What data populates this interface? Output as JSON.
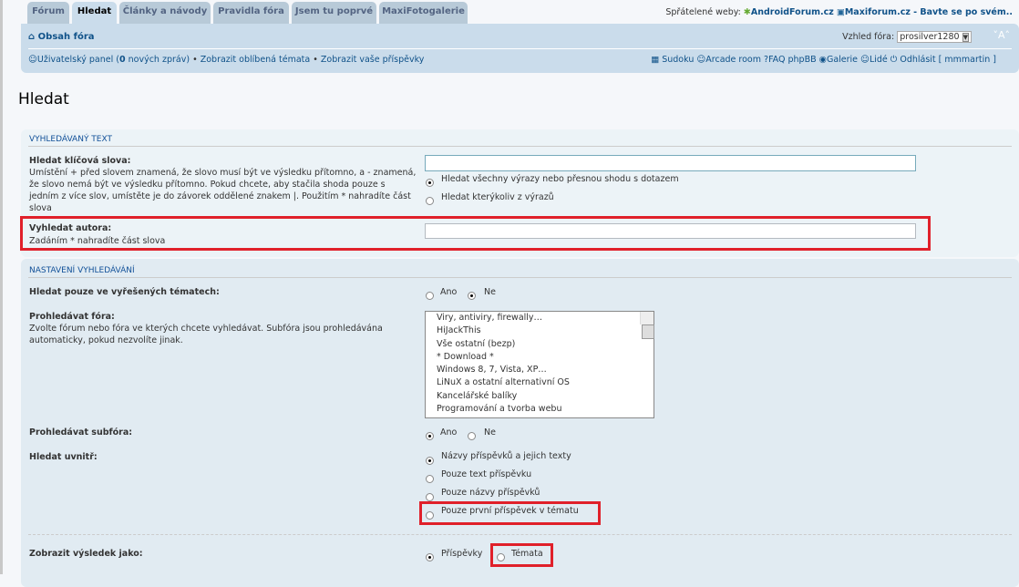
{
  "tabs": [
    "Fórum",
    "Hledat",
    "Články a návody",
    "Pravidla fóra",
    "Jsem tu poprvé",
    "MaxiFotogalerie"
  ],
  "friends": {
    "label": "Spřátelené weby:",
    "site1": "AndroidForum.cz",
    "site2": "Maxiforum.cz - Bavte se po svém.."
  },
  "nav": {
    "home": "Obsah fóra",
    "style_label": "Vzhled fóra:",
    "style_value": "prosilver1280",
    "font_size": "A",
    "ucp": "Uživatelský panel (",
    "new_count": "0",
    "new_msgs": " nových zpráv)",
    "bullet": "•",
    "fav": "Zobrazit oblíbená témata",
    "own": "Zobrazit vaše příspěvky",
    "right": [
      "Sudoku",
      "Arcade room",
      "FAQ phpBB",
      "Galerie",
      "Lidé",
      "Odhlásit [ mmmartin ]"
    ]
  },
  "page_title": "Hledat",
  "search_text": {
    "header": "Vyhledávaný text",
    "keywords_label": "Hledat klíčová slova:",
    "keywords_desc": "Umístění + před slovem znamená, že slovo musí být ve výsledku přítomno, a - znamená, že slovo nemá být ve výsledku přítomno. Pokud chcete, aby stačila shoda pouze s jedním z více slov, umístěte je do závorek oddělené znakem |. Použitím * nahradíte část slova",
    "opt_all": "Hledat všechny výrazy nebo přesnou shodu s dotazem",
    "opt_any": "Hledat kterýkoliv z výrazů",
    "author_label": "Vyhledat autora:",
    "author_desc": "Zadáním * nahradíte část slova"
  },
  "settings": {
    "header": "Nastavení vyhledávání",
    "solved_label": "Hledat pouze ve vyřešených tématech:",
    "yes": "Ano",
    "no": "Ne",
    "forums_label": "Prohledávat fóra:",
    "forums_desc": "Zvolte fórum nebo fóra ve kterých chcete vyhledávat. Subfóra jsou prohledávána automaticky, pokud nezvolíte jinak.",
    "forums": [
      "Viry, antiviry, firewally…",
      "HiJackThis",
      "Vše ostatní (bezp)",
      "* Download *",
      "Windows 8, 7, Vista, XP…",
      "LiNuX a ostatní alternativní OS",
      "Kancelářské balíky",
      "Programování a tvorba webu"
    ],
    "subforums_label": "Prohledávat subfóra:",
    "within_label": "Hledat uvnitř:",
    "within": [
      "Názvy příspěvků a jejich texty",
      "Pouze text příspěvku",
      "Pouze názvy příspěvků",
      "Pouze první příspěvek v tématu"
    ],
    "display_label": "Zobrazit výsledek jako:",
    "display_posts": "Příspěvky",
    "display_topics": "Témata"
  }
}
